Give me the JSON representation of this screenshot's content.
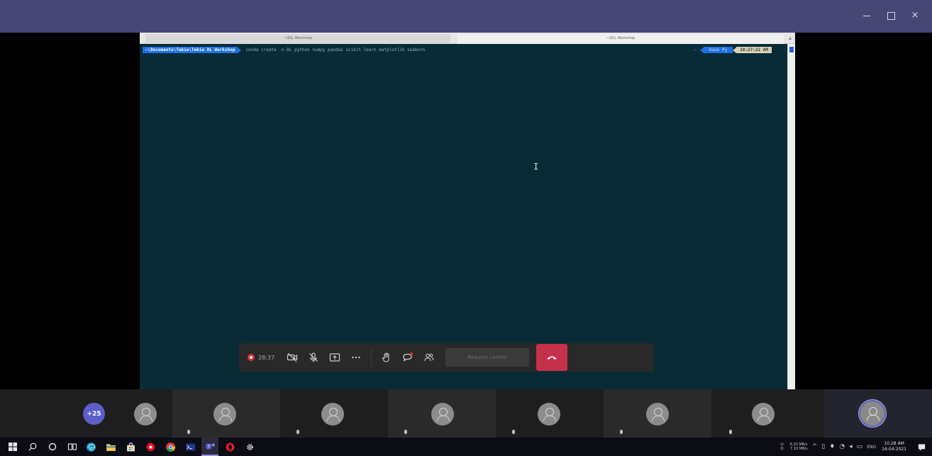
{
  "window": {
    "controls": {
      "minimize": "–",
      "maximize": "□",
      "close": "×"
    }
  },
  "terminal": {
    "tabs": [
      "~\\D\\L Workshop",
      "~\\D\\L Workshop"
    ],
    "prompt_path": "~\\Documents\\Tekie\\Tekie DL Workshop",
    "command": "conda create -n DL python numpy pandas scikit-learn matplotlib seaborn",
    "right_prompt": {
      "mark": "✓",
      "env": "base Py",
      "time": "10:27:22 AM"
    },
    "cursor": "I"
  },
  "callbar": {
    "timer": "28:37",
    "leave_text": "Request control"
  },
  "gallery": {
    "overflow_count": "+25"
  },
  "taskbar": {
    "network": {
      "up_label": "U:",
      "up_speed": "8.20 MB/s",
      "down_label": "D:",
      "down_speed": "7.10 MB/s"
    },
    "language": "ENG",
    "time": "10:28 AM",
    "date": "16-04-2021"
  },
  "colors": {
    "teams_purple": "#464775",
    "terminal_bg": "#082b36",
    "prompt_blue": "#1f6fe5",
    "hangup_red": "#c4314b",
    "avatar_grey": "#8c8c8c"
  }
}
